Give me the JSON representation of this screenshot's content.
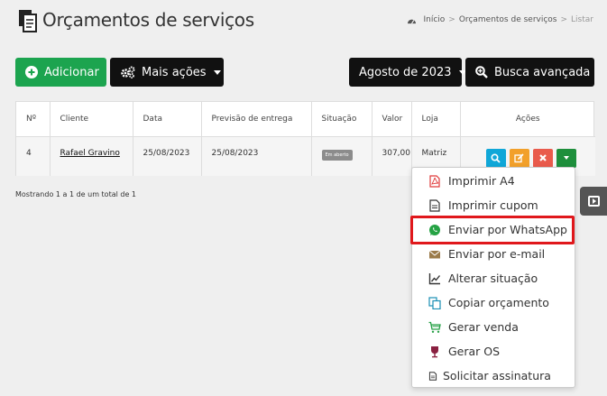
{
  "header": {
    "title": "Orçamentos de serviços",
    "breadcrumb": [
      "Início",
      "Orçamentos de serviços",
      "Listar"
    ]
  },
  "toolbar": {
    "add_label": "Adicionar",
    "more_label": "Mais ações",
    "month_label": "Agosto de 2023",
    "search_label": "Busca avançada"
  },
  "table": {
    "headers": [
      "Nº",
      "Cliente",
      "Data",
      "Previsão de entrega",
      "Situação",
      "Valor",
      "Loja",
      "Ações"
    ],
    "rows": [
      {
        "number": "4",
        "client": "Rafael Gravino",
        "date": "25/08/2023",
        "delivery": "25/08/2023",
        "status": "Em aberto",
        "value": "307,00",
        "store": "Matriz"
      }
    ]
  },
  "summary": "Mostrando 1 a 1 de um total de 1",
  "menu": {
    "items": [
      {
        "label": "Imprimir A4",
        "icon": "pdf-icon"
      },
      {
        "label": "Imprimir cupom",
        "icon": "file-icon"
      },
      {
        "label": "Enviar por WhatsApp",
        "icon": "whatsapp-icon"
      },
      {
        "label": "Enviar por e-mail",
        "icon": "envelope-icon"
      },
      {
        "label": "Alterar situação",
        "icon": "chart-line-icon"
      },
      {
        "label": "Copiar orçamento",
        "icon": "copy-icon"
      },
      {
        "label": "Gerar venda",
        "icon": "cart-icon"
      },
      {
        "label": "Gerar OS",
        "icon": "wine-glass-icon"
      },
      {
        "label": "Solicitar assinatura",
        "icon": "signature-file-icon"
      }
    ]
  },
  "colors": {
    "accent_green": "#1ca44f",
    "search_blue": "#10a7d8",
    "edit_orange": "#f2a02a",
    "delete_red": "#e95b4c",
    "more_green": "#1e8f3c",
    "highlight_red": "#e0181c"
  }
}
